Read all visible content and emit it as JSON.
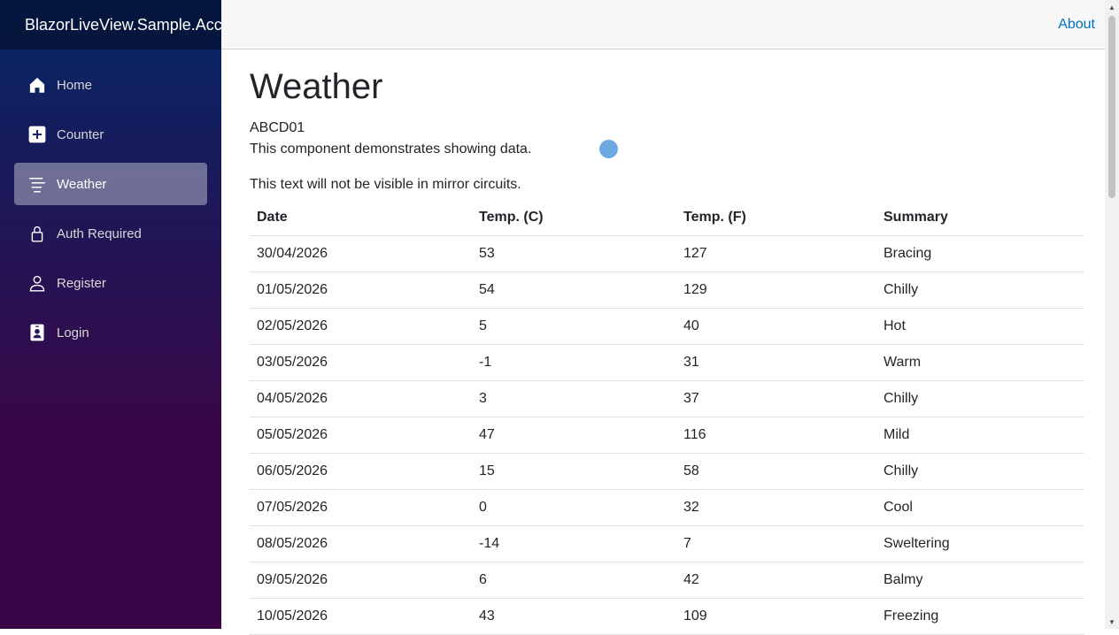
{
  "sidebar": {
    "brand": "BlazorLiveView.Sample.Accounts",
    "items": [
      {
        "label": "Home",
        "icon": "house-icon",
        "active": false
      },
      {
        "label": "Counter",
        "icon": "plus-square-icon",
        "active": false
      },
      {
        "label": "Weather",
        "icon": "list-icon",
        "active": true
      },
      {
        "label": "Auth Required",
        "icon": "lock-icon",
        "active": false
      },
      {
        "label": "Register",
        "icon": "person-icon",
        "active": false
      },
      {
        "label": "Login",
        "icon": "person-badge-icon",
        "active": false
      }
    ]
  },
  "top_row": {
    "about": "About"
  },
  "main": {
    "title": "Weather",
    "circuit_id": "ABCD01",
    "description": "This component demonstrates showing data.",
    "mirror_note": "This text will not be visible in mirror circuits.",
    "table": {
      "headers": [
        "Date",
        "Temp. (C)",
        "Temp. (F)",
        "Summary"
      ],
      "rows": [
        [
          "30/04/2026",
          "53",
          "127",
          "Bracing"
        ],
        [
          "01/05/2026",
          "54",
          "129",
          "Chilly"
        ],
        [
          "02/05/2026",
          "5",
          "40",
          "Hot"
        ],
        [
          "03/05/2026",
          "-1",
          "31",
          "Warm"
        ],
        [
          "04/05/2026",
          "3",
          "37",
          "Chilly"
        ],
        [
          "05/05/2026",
          "47",
          "116",
          "Mild"
        ],
        [
          "06/05/2026",
          "15",
          "58",
          "Chilly"
        ],
        [
          "07/05/2026",
          "0",
          "32",
          "Cool"
        ],
        [
          "08/05/2026",
          "-14",
          "7",
          "Sweltering"
        ],
        [
          "09/05/2026",
          "6",
          "42",
          "Balmy"
        ],
        [
          "10/05/2026",
          "43",
          "109",
          "Freezing"
        ]
      ]
    }
  },
  "colors": {
    "sidebar_top": "#052767",
    "sidebar_bottom": "#3a0647",
    "link": "#0071c1",
    "active_item": "#ffffff5e"
  }
}
